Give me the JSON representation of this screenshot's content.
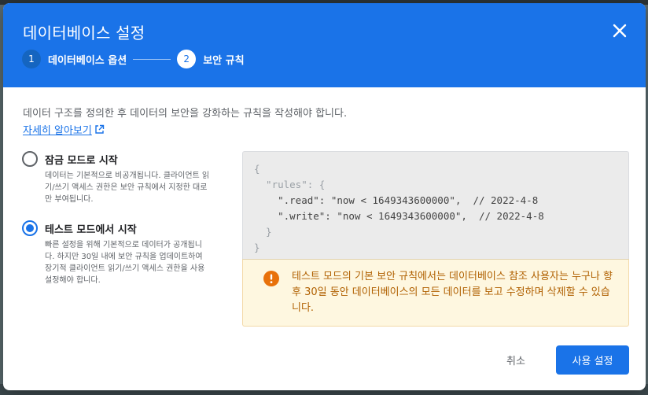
{
  "dialog": {
    "title": "데이터베이스 설정",
    "close_icon": "close-icon"
  },
  "stepper": {
    "steps": [
      {
        "number": "1",
        "label": "데이터베이스 옵션",
        "state": "completed"
      },
      {
        "number": "2",
        "label": "보안 규칙",
        "state": "active"
      }
    ]
  },
  "intro": {
    "text": "데이터 구조를 정의한 후 데이터의 보안을 강화하는 규칙을 작성해야 합니다.",
    "link_label": "자세히 알아보기",
    "link_icon": "open-in-new-icon"
  },
  "options": [
    {
      "title": "잠금 모드로 시작",
      "description": "데이터는 기본적으로 비공개됩니다. 클라이언트 읽기/쓰기 액세스 권한은 보안 규칙에서 지정한 대로만 부여됩니다.",
      "selected": false
    },
    {
      "title": "테스트 모드에서 시작",
      "description": "빠른 설정을 위해 기본적으로 데이터가 공개됩니다. 하지만 30일 내에 보안 규칙을 업데이트하여 장기적 클라이언트 읽기/쓰기 액세스 권한을 사용 설정해야 합니다.",
      "selected": true
    }
  ],
  "rules_code": {
    "line1": "{",
    "line2": "  \"rules\": {",
    "line3": "    \".read\": \"now < 1649343600000\",  // 2022-4-8",
    "line4": "    \".write\": \"now < 1649343600000\",  // 2022-4-8",
    "line5": "  }",
    "line6": "}"
  },
  "warning": {
    "icon": "error-icon",
    "text": "테스트 모드의 기본 보안 규칙에서는 데이터베이스 참조 사용자는 누구나 향후 30일 동안 데이터베이스의 모든 데이터를 보고 수정하며 삭제할 수 있습니다."
  },
  "actions": {
    "cancel_label": "취소",
    "confirm_label": "사용 설정"
  },
  "colors": {
    "primary": "#1a73e8",
    "warning_text": "#b06000",
    "warning_bg": "#fef7e0",
    "code_bg": "#ebebeb"
  }
}
